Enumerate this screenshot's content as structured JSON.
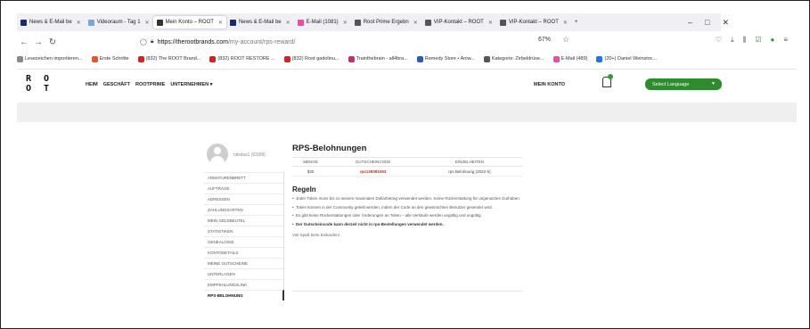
{
  "browser": {
    "tabs": [
      {
        "label": "News & E-Mail be",
        "color": "#1a2b6d",
        "active": false
      },
      {
        "label": "Videoraum - Tag 1",
        "color": "#7aa6d6",
        "active": false
      },
      {
        "label": "Mein Konto – ROOT",
        "color": "#333333",
        "active": true
      },
      {
        "label": "News & E-Mail be",
        "color": "#1a2b6d",
        "active": false
      },
      {
        "label": "E-Mail (1081)",
        "color": "#e94f9c",
        "active": false
      },
      {
        "label": "Root Prime Ergebn",
        "color": "#555555",
        "active": false
      },
      {
        "label": "VIP-Kontakt – ROOT",
        "color": "#555555",
        "active": false
      },
      {
        "label": "VIP-Kontakt – ROOT",
        "color": "#555555",
        "active": false
      }
    ],
    "new_tab": "+",
    "window_controls": [
      "–",
      "□",
      "✕"
    ],
    "url_host": "https://therootbrands.com",
    "url_path": "/my-account/rps-reward/",
    "zoom": "67%",
    "bookmarks": [
      {
        "label": "Lesezeichen importieren...",
        "color": "#888888"
      },
      {
        "label": "Erste Schritte",
        "color": "#e8542b"
      },
      {
        "label": "(832) The ROOT Brand...",
        "color": "#d92020"
      },
      {
        "label": "(832) ROOT RESTORE ...",
        "color": "#d92020"
      },
      {
        "label": "(832) Root gadolinu...",
        "color": "#d92020"
      },
      {
        "label": "Trainthebrain - all4bra...",
        "color": "#c03070"
      },
      {
        "label": "Remedy Store • Aniw...",
        "color": "#2a5db0"
      },
      {
        "label": "Kategorie: Zirbeldrüse...",
        "color": "#555555"
      },
      {
        "label": "E-Mail (489)",
        "color": "#e94f9c"
      },
      {
        "label": "(20+) Daniel Weinstoc...",
        "color": "#1877f2"
      }
    ]
  },
  "site": {
    "logo_line1": "R O",
    "logo_line2": "O T",
    "nav": [
      "HEIM",
      "GESCHÄFT",
      "ROOTPRIME",
      "UNTERNEHMEN ▾"
    ],
    "account_label": "MEIN KONTO",
    "language_label": "Select Language",
    "accent": "#2e8b2e"
  },
  "sidebar": {
    "username": "nicolas1 (63)09)",
    "items": [
      {
        "label": "ARMATURENBRETT",
        "active": false
      },
      {
        "label": "AUFTRÄGE",
        "active": false
      },
      {
        "label": "ADRESSEN",
        "active": false
      },
      {
        "label": "ZAHLUNGSARTEN",
        "active": false
      },
      {
        "label": "MEIN GELDBEUTEL",
        "active": false
      },
      {
        "label": "STATISTIKEN",
        "active": false
      },
      {
        "label": "GENEALOGIE",
        "active": false
      },
      {
        "label": "KONTODETAILS",
        "active": false
      },
      {
        "label": "MEINE GUTSCHEINE",
        "active": false
      },
      {
        "label": "UNTERLAGEN",
        "active": false
      },
      {
        "label": "EMPFEHLUNGSLINK",
        "active": false
      },
      {
        "label": "RPS-BELOHNUNG",
        "active": true
      }
    ]
  },
  "main": {
    "title": "RPS-Belohnungen",
    "table": {
      "headers": [
        "MENGE",
        "GUTSCHEINCODE",
        "EINZELHEITEN"
      ],
      "rows": [
        [
          "$30",
          "rps139381093",
          "rps Belohnung (2022-5)"
        ]
      ]
    },
    "rules_title": "Regeln",
    "rules": [
      {
        "text": "Jeder Token muss bis zu seinem maximalen Dollarbetrag verwendet werden. Keine Rückerstattung für ungenutztes Guthaben.",
        "bold": false
      },
      {
        "text": "Token können in der Community geteilt werden, indem der Code an den gewünschten Benutzer gesendet wird.",
        "bold": false
      },
      {
        "text": "Es gibt keine Rückerstattungen oder Änderungen an Token – alle Verkäufe werden ungültig und ungültig.",
        "bold": false
      },
      {
        "text": "Der Gutscheincode kann derzeit nicht in rps-Bestellungen verwendet werden.",
        "bold": true
      }
    ],
    "enjoy": "Viel Spaß beim Einkaufen!"
  }
}
